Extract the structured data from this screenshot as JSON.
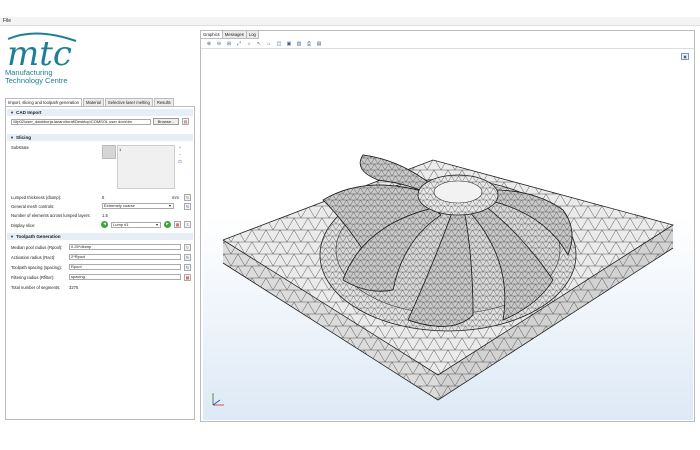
{
  "menubar": {
    "file_label": "File"
  },
  "logo": {
    "mark": "mtc",
    "line1": "Manufacturing",
    "line2": "Technology Centre"
  },
  "left_tabs": [
    "Import, slicing and toolpath generation",
    "Material",
    "Selective laser melting",
    "Results"
  ],
  "cad_import": {
    "title": "CAD Import",
    "path_value": "\\\\lfp02\\user_data\\borja.lazaro\\toraf\\Desktop\\COMSOL user docs\\Im",
    "browse_label": "Browse..."
  },
  "slicing": {
    "title": "Slicing",
    "substrate_label": "Substrate",
    "substrate_index": "1",
    "lumped_thickness_label": "Lumped thickness (dlump):",
    "lumped_thickness_value": "5",
    "lumped_thickness_unit": "mm",
    "mesh_controls_label": "General mesh controls:",
    "mesh_controls_value": "Extremely coarse",
    "num_elements_label": "Number of elements across lumped layers:",
    "num_elements_value": "1.5",
    "display_slice_label": "Display slice:",
    "display_slice_value": "Lump #1"
  },
  "toolpath": {
    "title": "Toolpath Generation",
    "median_pool_label": "Median pool radius (Rpool):",
    "median_pool_value": "0.25*dlump",
    "activation_label": "Activation radius (Ract):",
    "activation_value": "2*Rpool",
    "spacing_label": "Toolpath spacing (spacing):",
    "spacing_value": "Rpool",
    "filtering_label": "Filtering radius (Rfilter):",
    "filtering_value": "spacing",
    "total_label": "Total number of segments:",
    "total_value": "3275"
  },
  "right_tabs": [
    "Graphics",
    "Messages",
    "Log"
  ],
  "toolbar_icons": [
    "zoom-in-icon",
    "zoom-out-icon",
    "zoom-box-icon",
    "zoom-extents-icon",
    "scene-light-icon",
    "select-icon",
    "go-to-default-view-icon",
    "transparency-icon",
    "wireframe-icon",
    "render-mode-icon",
    "print-icon",
    "export-image-icon"
  ],
  "colors": {
    "brand": "#1d7f96",
    "section_bg": "#e8eef6",
    "mesh_face": "#e6e6e6",
    "mesh_line": "#333333",
    "green": "#3aa63a"
  }
}
